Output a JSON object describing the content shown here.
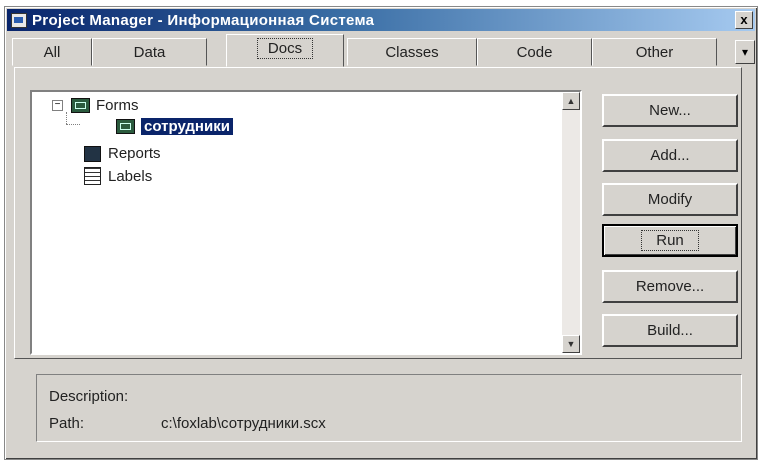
{
  "window": {
    "title": "Project Manager - Информационная Система",
    "close_label": "x"
  },
  "tabs": [
    {
      "label": "All"
    },
    {
      "label": "Data"
    },
    {
      "label": "Docs",
      "active": true
    },
    {
      "label": "Classes"
    },
    {
      "label": "Code"
    },
    {
      "label": "Other"
    }
  ],
  "tab_more_label": "▾",
  "tree": {
    "forms": {
      "label": "Forms",
      "expanded": true,
      "expander": "−"
    },
    "form_item": {
      "label": "сотрудники",
      "selected": true
    },
    "reports": {
      "label": "Reports"
    },
    "labels": {
      "label": "Labels"
    }
  },
  "buttons": {
    "new": "New...",
    "add": "Add...",
    "modify": "Modify",
    "run": "Run",
    "remove": "Remove...",
    "build": "Build..."
  },
  "details": {
    "description_label": "Description:",
    "description_value": "",
    "path_label": "Path:",
    "path_value": "c:\\foxlab\\сотрудники.scx"
  },
  "colors": {
    "title_bar": "#08246b",
    "selection": "#0a246a",
    "face": "#d6d3ce"
  }
}
